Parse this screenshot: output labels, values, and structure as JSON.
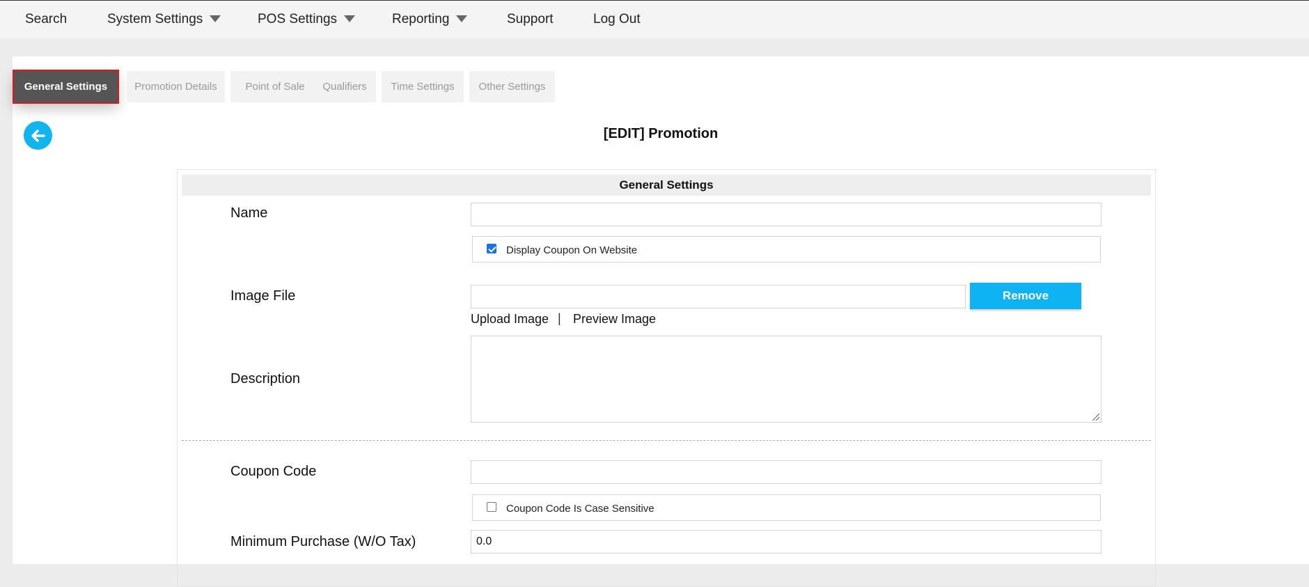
{
  "nav": {
    "search": "Search",
    "system_settings": "System Settings",
    "pos_settings": "POS Settings",
    "reporting": "Reporting",
    "support": "Support",
    "logout": "Log Out"
  },
  "tabs": {
    "general": "General Settings",
    "promotion_details": "Promotion Details",
    "point_of_sale": "Point of Sale",
    "qualifiers": "Qualifiers",
    "time_settings": "Time Settings",
    "other_settings": "Other Settings"
  },
  "page": {
    "title": "[EDIT] Promotion",
    "section_title": "General Settings"
  },
  "form": {
    "name_label": "Name",
    "name_value": "",
    "display_coupon_label": "Display Coupon On Website",
    "display_coupon_checked": true,
    "image_label": "Image File",
    "image_value": "",
    "remove_label": "Remove",
    "upload_label": "Upload Image",
    "separator": "|",
    "preview_label": "Preview Image",
    "description_label": "Description",
    "description_value": "",
    "coupon_code_label": "Coupon Code",
    "coupon_code_value": "",
    "case_sensitive_label": "Coupon Code Is Case Sensitive",
    "case_sensitive_checked": false,
    "min_purchase_label": "Minimum Purchase (W/O Tax)",
    "min_purchase_value": "0.0"
  },
  "colors": {
    "accent": "#0fb3f2",
    "active_tab": "#555555",
    "active_tab_outline": "#e0161c"
  },
  "icons": {
    "back": "arrow-left-circle-icon",
    "dropdown": "caret-down-icon",
    "checkbox_checked": "checkbox-checked-icon",
    "checkbox_empty": "checkbox-empty-icon",
    "resize": "resize-handle-icon"
  }
}
